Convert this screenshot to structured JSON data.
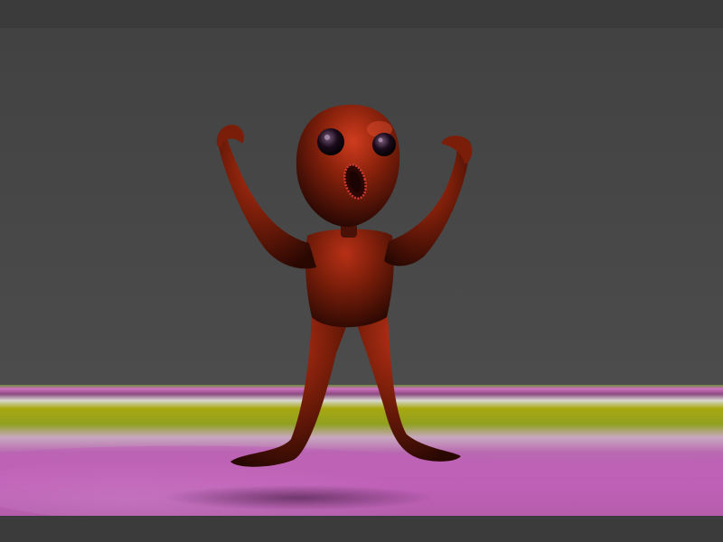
{
  "scene": {
    "subject": "red-glossy-alien-figure",
    "colors": {
      "background": "#3b3b3b",
      "backdrop": "#4a4a4a",
      "figure_base": "#5e1607",
      "figure_highlight": "#c03218",
      "floor_magenta": "#c060b0",
      "floor_olive": "#9a9a10",
      "floor_green": "#4a8a20"
    }
  }
}
